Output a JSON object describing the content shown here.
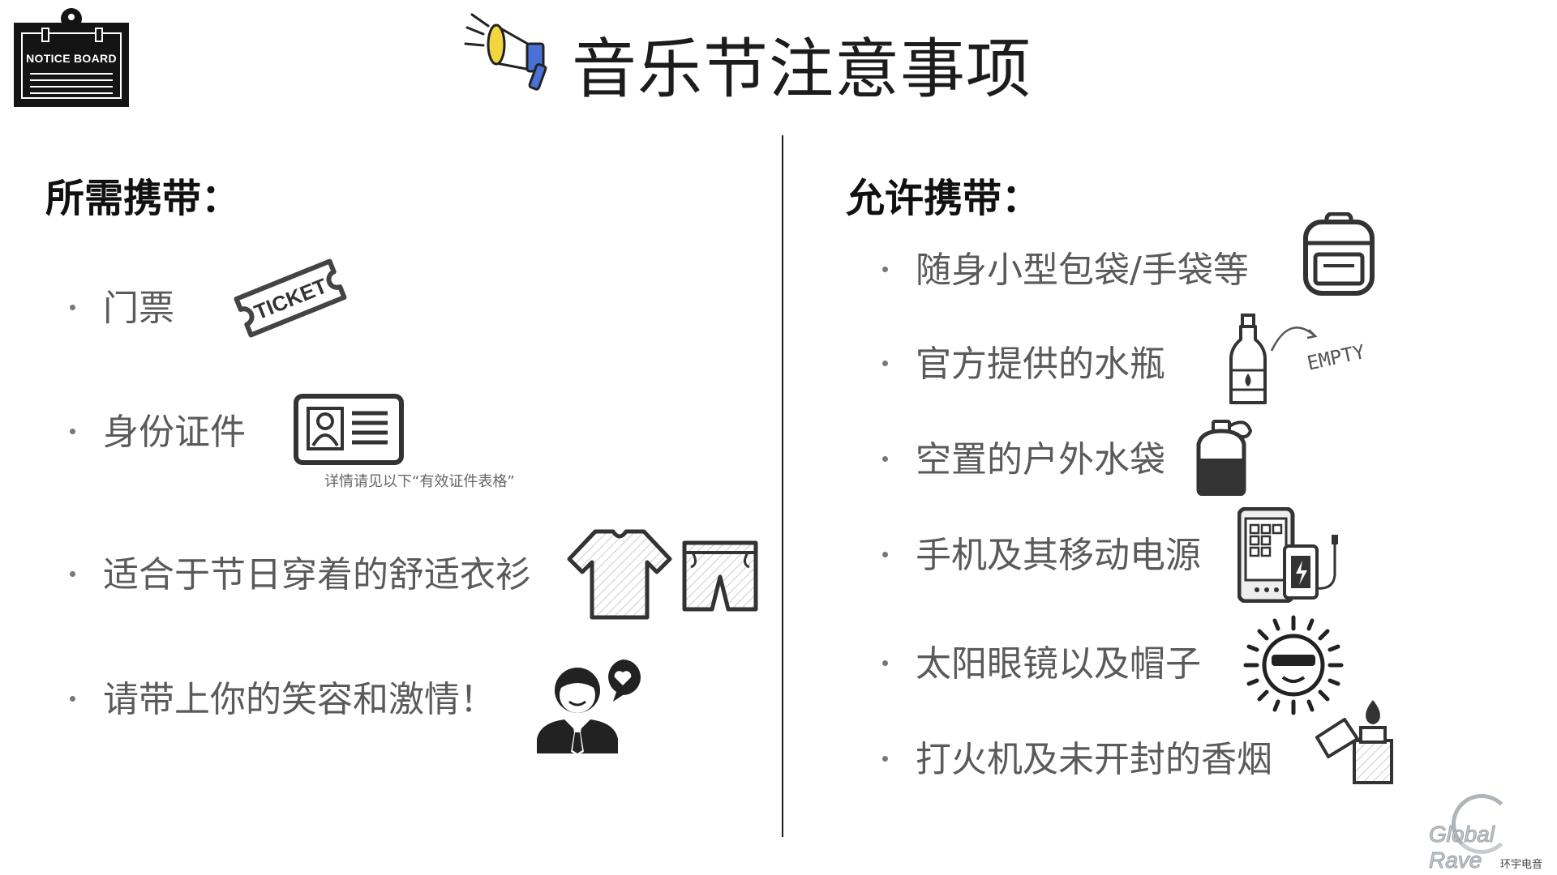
{
  "notice_board": {
    "label": "NOTICE BOARD"
  },
  "title": "音乐节注意事项",
  "left": {
    "heading": "所需携带：",
    "items": [
      {
        "text": "门票",
        "icon": "ticket-icon",
        "icon_text": "TICKET"
      },
      {
        "text": "身份证件",
        "icon": "id-card-icon",
        "note": "详情请见以下“有效证件表格”"
      },
      {
        "text": "适合于节日穿着的舒适衣衫",
        "icon": "clothes-icon"
      },
      {
        "text": "请带上你的笑容和激情！",
        "icon": "smiling-person-icon"
      }
    ]
  },
  "right": {
    "heading": "允许携带：",
    "items": [
      {
        "text": "随身小型包袋/手袋等",
        "icon": "backpack-icon"
      },
      {
        "text": "官方提供的水瓶",
        "icon": "water-bottle-icon",
        "icon_text": "EMPTY"
      },
      {
        "text": "空置的户外水袋",
        "icon": "water-pouch-icon"
      },
      {
        "text": "手机及其移动电源",
        "icon": "phone-powerbank-icon"
      },
      {
        "text": "太阳眼镜以及帽子",
        "icon": "sunglasses-sun-icon"
      },
      {
        "text": "打火机及未开封的香烟",
        "icon": "lighter-icon"
      }
    ]
  },
  "logo": {
    "name": "Global Rave",
    "subtitle": "环宇电音"
  }
}
